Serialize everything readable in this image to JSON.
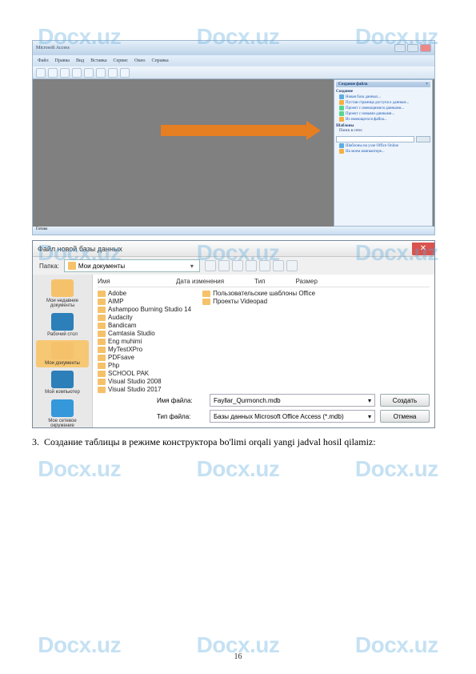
{
  "watermark": "Docx.uz",
  "page_number": "16",
  "paragraph": {
    "number": "3.",
    "text": "Создание  таблицы  в  режиме  конструктора  bo'limi  orqali  yangi  jadval  hosil qilamiz:"
  },
  "shot1": {
    "title": "Microsoft Access",
    "menu": [
      "Файл",
      "Правка",
      "Вид",
      "Вставка",
      "Сервис",
      "Окно",
      "Справка"
    ],
    "taskpane_title": "Создание файла",
    "section1": "Создание",
    "items1": [
      "Новая база данных...",
      "Пустая страница доступа к данным...",
      "Проект с имеющимися данными...",
      "Проект с новыми данными...",
      "Из имеющегося файла..."
    ],
    "section2": "Шаблоны",
    "search_label": "Поиск в сети:",
    "items2": [
      "Шаблоны на узле Office Online",
      "На моем компьютере..."
    ],
    "status": "Готово"
  },
  "shot2": {
    "title": "Файл новой базы данных",
    "folder_label": "Папка:",
    "folder_value": "Мои документы",
    "columns": [
      "Имя",
      "Дата изменения",
      "Тип",
      "Размер"
    ],
    "places": [
      "Мои недавние документы",
      "Рабочий стол",
      "Мои документы",
      "Мой компьютер",
      "Мое сетевое окружение"
    ],
    "files_col1": [
      "Adobe",
      "AIMP",
      "Ashampoo Burning Studio 14",
      "Audacity",
      "Bandicam",
      "Camtasia Studio",
      "Eng muhimi",
      "MyTestXPro",
      "PDFsave",
      "Php",
      "SCHOOL PAK",
      "Visual Studio 2008",
      "Visual Studio 2017"
    ],
    "files_col2": [
      "Пользовательские шаблоны Office",
      "Проекты Videopad"
    ],
    "filename_label": "Имя файла:",
    "filename_value": "Fayllar_Qurmonch.mdb",
    "filetype_label": "Тип файла:",
    "filetype_value": "Базы данных Microsoft Office Access (*.mdb)",
    "btn_create": "Создать",
    "btn_cancel": "Отмена"
  }
}
